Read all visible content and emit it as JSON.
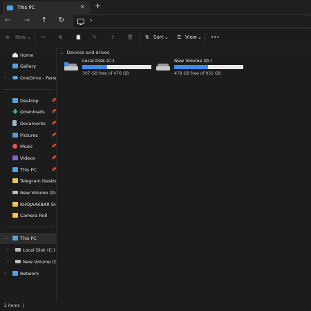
{
  "tab": {
    "title": "This PC",
    "close_glyph": "×",
    "new_glyph": "+"
  },
  "nav": {
    "back": "←",
    "forward": "→",
    "up": "↑",
    "refresh": "↻",
    "chevron": "›"
  },
  "toolbar": {
    "new_label": "New",
    "sort_label": "Sort",
    "view_label": "View",
    "more_glyph": "•••",
    "cut_glyph": "✂",
    "copy_glyph": "⧉",
    "paste_glyph": "📋",
    "rename_glyph": "✎",
    "share_glyph": "⇪",
    "delete_glyph": "🗑"
  },
  "sidebar": {
    "items": [
      {
        "label": "Home",
        "icon": "home-icon"
      },
      {
        "label": "Gallery",
        "icon": "gallery-icon"
      },
      {
        "label": "OneDrive - Persona",
        "icon": "cloud-icon"
      },
      {
        "label": "Desktop",
        "icon": "desktop-icon",
        "pinned": true
      },
      {
        "label": "Downloads",
        "icon": "download-icon",
        "pinned": true
      },
      {
        "label": "Documents",
        "icon": "documents-icon",
        "pinned": true
      },
      {
        "label": "Pictures",
        "icon": "pictures-icon",
        "pinned": true
      },
      {
        "label": "Music",
        "icon": "music-icon",
        "pinned": true
      },
      {
        "label": "Videos",
        "icon": "videos-icon",
        "pinned": true
      },
      {
        "label": "This PC",
        "icon": "pc-icon",
        "pinned": true
      },
      {
        "label": "Telegram Desktop",
        "icon": "folder-icon"
      },
      {
        "label": "New Volume (D:)",
        "icon": "drive-icon"
      },
      {
        "label": "KHOJAAKBAR SHAX",
        "icon": "folder-icon"
      },
      {
        "label": "Camera Roll",
        "icon": "folder-icon"
      },
      {
        "label": "This PC",
        "icon": "pc-icon"
      },
      {
        "label": "Local Disk (C:)",
        "icon": "drive-icon"
      },
      {
        "label": "New Volume (D:)",
        "icon": "drive-icon"
      },
      {
        "label": "Network",
        "icon": "network-icon"
      }
    ]
  },
  "content": {
    "group_title": "Devices and drives",
    "drives": [
      {
        "name": "Local Disk (C:)",
        "free_text": "307 GB free of 476 GB",
        "used_fraction": 0.355
      },
      {
        "name": "New Volume (D:)",
        "free_text": "478 GB free of 931 GB",
        "used_fraction": 0.487
      }
    ]
  },
  "status": {
    "items_text": "2 items",
    "separator": "|"
  },
  "colors": {
    "accent": "#3a8ee6",
    "folder": "#f2c24f",
    "background": "#1c1c1c"
  }
}
